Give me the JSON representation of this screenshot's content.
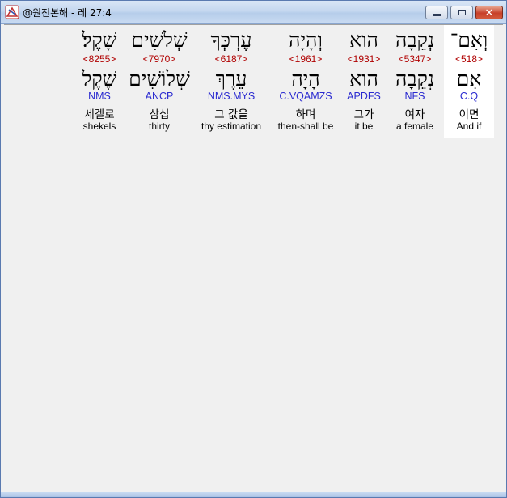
{
  "window": {
    "title": "@원전본해 - 레 27:4",
    "close_glyph": "✕"
  },
  "words": [
    {
      "hebrew": "שָׁקֶל׃",
      "strong": "<8255>",
      "lemma": "שֶׁקֶל",
      "morph": "NMS",
      "korean": "세겔로",
      "english": "shekels"
    },
    {
      "hebrew": "שְׁלֹשִׁים",
      "strong": "<7970>",
      "lemma": "שְׁלוֹשִׁים",
      "morph": "ANCP",
      "korean": "삼십",
      "english": "thirty"
    },
    {
      "hebrew": "עֶרְכְּךָ",
      "strong": "<6187>",
      "lemma": "עֵרֶךְ",
      "morph": "NMS.MYS",
      "korean": "그 값을",
      "english": "thy estimation"
    },
    {
      "hebrew": "וְהָיָה",
      "strong": "<1961>",
      "lemma": "הָיָה",
      "morph": "C.VQAMZS",
      "korean": "하며",
      "english": "then-shall be"
    },
    {
      "hebrew": "הוא",
      "strong": "<1931>",
      "lemma": "הוא",
      "morph": "APDFS",
      "korean": "그가",
      "english": "it be"
    },
    {
      "hebrew": "נְקֵבָה",
      "strong": "<5347>",
      "lemma": "נְקֵבָה",
      "morph": "NFS",
      "korean": "여자",
      "english": "a female"
    },
    {
      "hebrew": "וְאִם־",
      "strong": "<518>",
      "lemma": "אִם",
      "morph": "C.Q",
      "korean": "이면",
      "english": "And if",
      "selected": true
    }
  ]
}
